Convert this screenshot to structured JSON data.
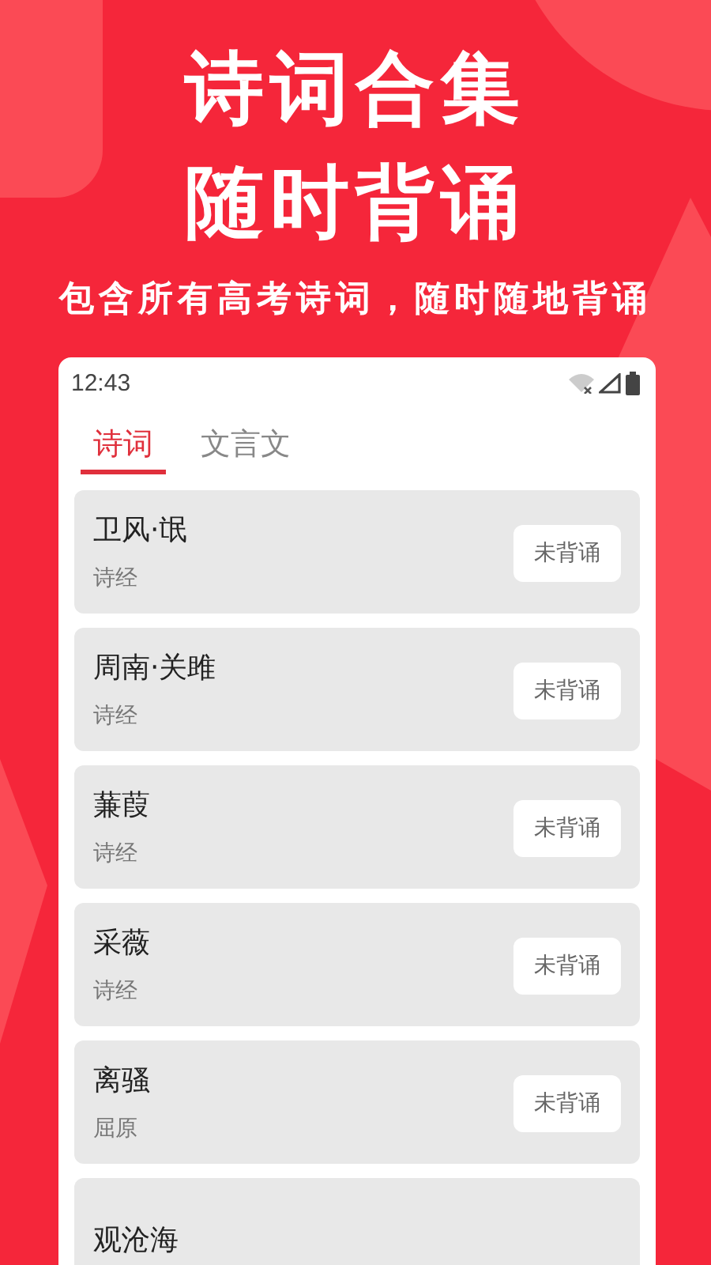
{
  "headline": [
    "诗词合集",
    "随时背诵"
  ],
  "subtitle": "包含所有高考诗词，随时随地背诵",
  "status_bar": {
    "time": "12:43"
  },
  "tabs": [
    {
      "label": "诗词",
      "selected": true
    },
    {
      "label": "文言文",
      "selected": false
    }
  ],
  "poems": [
    {
      "title": "卫风·氓",
      "author": "诗经",
      "button": "未背诵"
    },
    {
      "title": "周南·关雎",
      "author": "诗经",
      "button": "未背诵"
    },
    {
      "title": "蒹葭",
      "author": "诗经",
      "button": "未背诵"
    },
    {
      "title": "采薇",
      "author": "诗经",
      "button": "未背诵"
    },
    {
      "title": "离骚",
      "author": "屈原",
      "button": "未背诵"
    },
    {
      "title": "观沧海"
    }
  ]
}
